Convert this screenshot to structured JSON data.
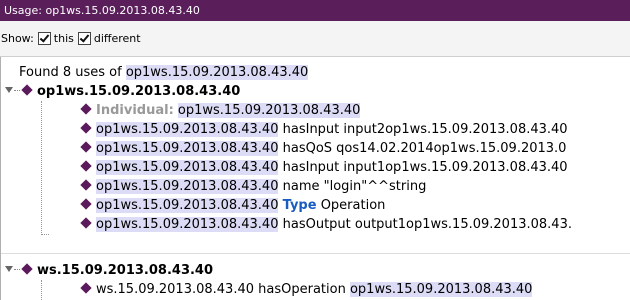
{
  "window": {
    "title": "Usage: op1ws.15.09.2013.08.43.40"
  },
  "show_bar": {
    "label": "Show:",
    "checkbox_this": "this",
    "checkbox_different": "different"
  },
  "summary": {
    "prefix": "Found 8 uses of",
    "entity": "op1ws.15.09.2013.08.43.40"
  },
  "groups": [
    {
      "header": "op1ws.15.09.2013.08.43.40",
      "rows": [
        {
          "label": "Individual:",
          "entity": "op1ws.15.09.2013.08.43.40"
        },
        {
          "subject": "op1ws.15.09.2013.08.43.40",
          "text": "hasInput input2op1ws.15.09.2013.08.43.40"
        },
        {
          "subject": "op1ws.15.09.2013.08.43.40",
          "text": "hasQoS qos14.02.2014op1ws.15.09.2013.0"
        },
        {
          "subject": "op1ws.15.09.2013.08.43.40",
          "text": "hasInput input1op1ws.15.09.2013.08.43.40"
        },
        {
          "subject": "op1ws.15.09.2013.08.43.40",
          "text": "name \"login\"^^string"
        },
        {
          "subject": "op1ws.15.09.2013.08.43.40",
          "keyword": "Type",
          "text": "Operation"
        },
        {
          "subject": "op1ws.15.09.2013.08.43.40",
          "text": "hasOutput output1op1ws.15.09.2013.08.43."
        }
      ]
    },
    {
      "header": "ws.15.09.2013.08.43.40",
      "rows": [
        {
          "subject": "ws.15.09.2013.08.43.40",
          "text": "hasOperation",
          "object": "op1ws.15.09.2013.08.43.40"
        }
      ]
    }
  ]
}
